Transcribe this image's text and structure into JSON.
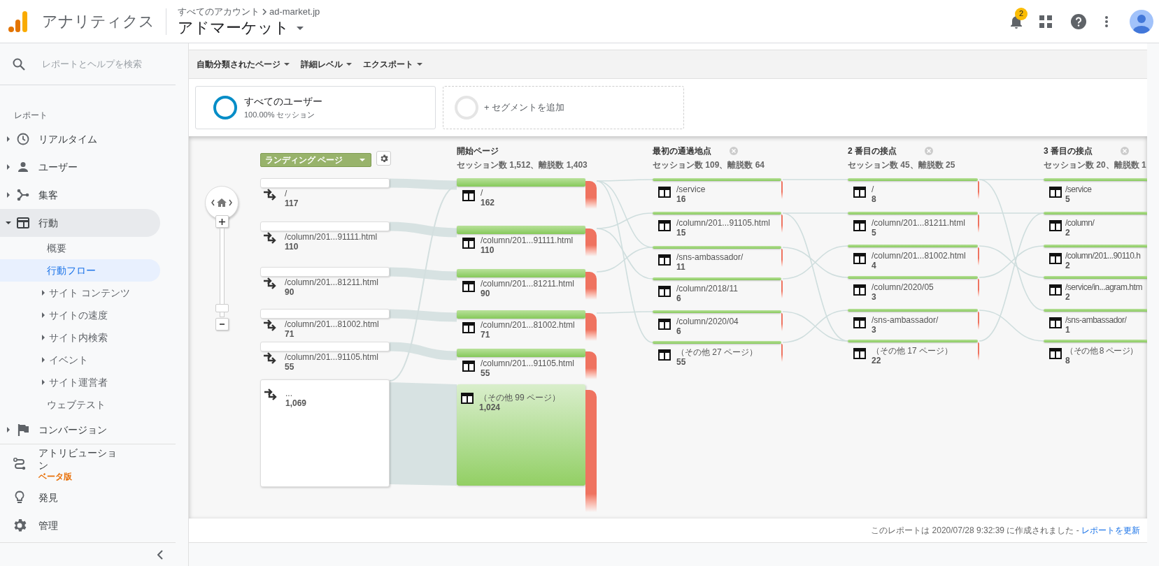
{
  "header": {
    "product": "アナリティクス",
    "breadcrumb": [
      "すべてのアカウント",
      "ad-market.jp"
    ],
    "property": "アドマーケット",
    "notification_count": "2"
  },
  "sidebar": {
    "search_placeholder": "レポートとヘルプを検索",
    "section_label": "レポート",
    "items": [
      {
        "label": "リアルタイム",
        "kind": "folder",
        "expanded": false,
        "selected": false
      },
      {
        "label": "ユーザー",
        "kind": "folder",
        "expanded": false,
        "selected": false
      },
      {
        "label": "集客",
        "kind": "folder",
        "expanded": false,
        "selected": false
      },
      {
        "label": "行動",
        "kind": "folder",
        "expanded": true,
        "selected": false,
        "children": [
          {
            "label": "概要",
            "kind": "page",
            "selected": false
          },
          {
            "label": "行動フロー",
            "kind": "page",
            "selected": true
          },
          {
            "label": "サイト コンテンツ",
            "kind": "folder",
            "expanded": false,
            "selected": false
          },
          {
            "label": "サイトの速度",
            "kind": "folder",
            "expanded": false,
            "selected": false
          },
          {
            "label": "サイト内検索",
            "kind": "folder",
            "expanded": false,
            "selected": false
          },
          {
            "label": "イベント",
            "kind": "folder",
            "expanded": false,
            "selected": false
          },
          {
            "label": "サイト運営者",
            "kind": "folder",
            "expanded": false,
            "selected": false
          },
          {
            "label": "ウェブテスト",
            "kind": "page",
            "selected": false
          }
        ]
      },
      {
        "label": "コンバージョン",
        "kind": "folder",
        "expanded": false,
        "selected": false
      }
    ],
    "bottom_items": [
      {
        "label": "アトリビューション",
        "badge": "ベータ版",
        "selected": false
      },
      {
        "label": "発見",
        "selected": false
      },
      {
        "label": "管理",
        "selected": false
      }
    ]
  },
  "toolbar": [
    "自動分類されたページ",
    "詳細レベル",
    "エクスポート"
  ],
  "segments": [
    {
      "kind": "segment",
      "name": "すべてのユーザー",
      "detail": "100.00% セッション"
    },
    {
      "kind": "add",
      "name": "+ セグメントを追加"
    }
  ],
  "flow": {
    "zoom": {
      "level": 0.06
    },
    "columns": [
      {
        "kind": "landing",
        "dimension": "ランディング ページ",
        "nodes": [
          {
            "kind": "page",
            "label": "/",
            "count": "117"
          },
          {
            "kind": "page",
            "label": "/column/201...91111.html",
            "count": "110"
          },
          {
            "kind": "page",
            "label": "/column/201...81211.html",
            "count": "90"
          },
          {
            "kind": "page",
            "label": "/column/201...81002.html",
            "count": "71"
          },
          {
            "kind": "page",
            "label": "/column/201...91105.html",
            "count": "55"
          },
          {
            "kind": "bulk",
            "label": "...",
            "count": "1,069"
          }
        ]
      },
      {
        "kind": "step",
        "title": "開始ページ",
        "stats": "セッション数 1,512、離脱数 1,403",
        "removable": false,
        "nodes": [
          {
            "kind": "page",
            "label": "/",
            "count": "162"
          },
          {
            "kind": "page",
            "label": "/column/201...91111.html",
            "count": "110"
          },
          {
            "kind": "page",
            "label": "/column/201...81211.html",
            "count": "90"
          },
          {
            "kind": "page",
            "label": "/column/201...81002.html",
            "count": "71"
          },
          {
            "kind": "page",
            "label": "/column/201...91105.html",
            "count": "55"
          },
          {
            "kind": "bulk",
            "label": "（その他 99 ページ）",
            "count": "1,024"
          }
        ]
      },
      {
        "kind": "step",
        "title": "最初の通過地点",
        "stats": "セッション数 109、離脱数 64",
        "removable": true,
        "nodes": [
          {
            "kind": "page",
            "label": "/service",
            "count": "16"
          },
          {
            "kind": "page",
            "label": "/column/201...91105.html",
            "count": "15"
          },
          {
            "kind": "page",
            "label": "/sns-ambassador/",
            "count": "11"
          },
          {
            "kind": "page",
            "label": "/column/2018/11",
            "count": "6"
          },
          {
            "kind": "page",
            "label": "/column/2020/04",
            "count": "6"
          },
          {
            "kind": "page",
            "label": "（その他 27 ページ）",
            "count": "55"
          }
        ]
      },
      {
        "kind": "step",
        "title": "2 番目の接点",
        "stats": "セッション数 45、離脱数 25",
        "removable": true,
        "nodes": [
          {
            "kind": "page",
            "label": "/",
            "count": "8"
          },
          {
            "kind": "page",
            "label": "/column/201...81211.html",
            "count": "5"
          },
          {
            "kind": "page",
            "label": "/column/201...81002.html",
            "count": "4"
          },
          {
            "kind": "page",
            "label": "/column/2020/05",
            "count": "3"
          },
          {
            "kind": "page",
            "label": "/sns-ambassador/",
            "count": "3"
          },
          {
            "kind": "page",
            "label": "（その他 17 ページ）",
            "count": "22"
          }
        ]
      },
      {
        "kind": "step",
        "title": "3 番目の接点",
        "stats": "セッション数 20、離脱数 1",
        "removable": true,
        "nodes": [
          {
            "kind": "page",
            "label": "/service",
            "count": "5"
          },
          {
            "kind": "page",
            "label": "/column/",
            "count": "2"
          },
          {
            "kind": "page",
            "label": "/column/201...90110.h",
            "count": "2"
          },
          {
            "kind": "page",
            "label": "/service/in...agram.htm",
            "count": "2"
          },
          {
            "kind": "page",
            "label": "/sns-ambassador/",
            "count": "1"
          },
          {
            "kind": "page",
            "label": "（その他 8 ページ）",
            "count": "8"
          }
        ]
      }
    ]
  },
  "footer": {
    "text": "このレポートは 2020/07/28 9:32:39 に作成されました - ",
    "link": "レポートを更新"
  }
}
